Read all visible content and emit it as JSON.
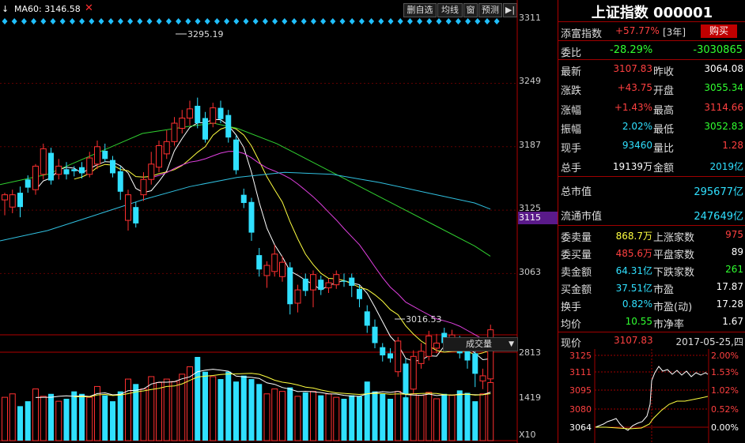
{
  "toolbar": {
    "arrow": "↓",
    "ma60_label": "MA60: 3146.58",
    "buttons": [
      "删自选",
      "均线",
      "窗",
      "预测"
    ],
    "collapse": "▶|"
  },
  "price_axis": [
    "3311",
    "3249",
    "3187",
    "3125",
    "3115",
    "3063"
  ],
  "current_price_tag": "3115",
  "annotations": {
    "high": "3295.19",
    "low": "3016.53"
  },
  "volume_selector": "成交量",
  "volume_axis": [
    "2813",
    "1419",
    "X10"
  ],
  "quote": {
    "title": "上证指数 000001",
    "tianfu_label": "添富指数",
    "tianfu_value": "+57.77%",
    "tianfu_period": "[3年]",
    "buy_button": "购买",
    "weibi_label": "委比",
    "weibi_value": "-28.29%",
    "weibi_diff": "-3030865",
    "rows": [
      {
        "l1": "最新",
        "v1": "3107.83",
        "c1": "red",
        "l2": "昨收",
        "v2": "3064.08",
        "c2": "white"
      },
      {
        "l1": "涨跌",
        "v1": "+43.75",
        "c1": "red",
        "l2": "开盘",
        "v2": "3055.34",
        "c2": "green"
      },
      {
        "l1": "涨幅",
        "v1": "+1.43%",
        "c1": "red",
        "l2": "最高",
        "v2": "3114.66",
        "c2": "red"
      },
      {
        "l1": "振幅",
        "v1": "2.02%",
        "c1": "cyan",
        "l2": "最低",
        "v2": "3052.83",
        "c2": "green"
      },
      {
        "l1": "现手",
        "v1": "93460",
        "c1": "cyan",
        "l2": "量比",
        "v2": "1.28",
        "c2": "red"
      },
      {
        "l1": "总手",
        "v1": "19139万",
        "c1": "white",
        "l2": "金额",
        "v2": "2019亿",
        "c2": "cyan"
      }
    ],
    "total_mv_label": "总市值",
    "total_mv": "295677亿",
    "float_mv_label": "流通市值",
    "float_mv": "247649亿",
    "rows2": [
      {
        "l1": "委卖量",
        "v1": "868.7万",
        "c1": "yellow",
        "l2": "上涨家数",
        "v2": "975",
        "c2": "red"
      },
      {
        "l1": "委买量",
        "v1": "485.6万",
        "c1": "red",
        "l2": "平盘家数",
        "v2": "89",
        "c2": "white"
      },
      {
        "l1": "卖金额",
        "v1": "64.31亿",
        "c1": "cyan",
        "l2": "下跌家数",
        "v2": "261",
        "c2": "green"
      },
      {
        "l1": "买金额",
        "v1": "37.51亿",
        "c1": "cyan",
        "l2": "市盈",
        "v2": "17.87",
        "c2": "white"
      },
      {
        "l1": "换手",
        "v1": "0.82%",
        "c1": "cyan",
        "l2": "市盈(动)",
        "v2": "17.28",
        "c2": "white"
      },
      {
        "l1": "均价",
        "v1": "10.55",
        "c1": "green",
        "l2": "市净率",
        "v2": "1.67",
        "c2": "white"
      }
    ],
    "price_label": "现价",
    "price_value": "3107.83",
    "date": "2017-05-25,四"
  },
  "mini_chart": {
    "left_axis": [
      "3125",
      "3111",
      "3095",
      "3080",
      "3064"
    ],
    "right_axis": [
      "2.00%",
      "1.53%",
      "1.02%",
      "0.52%",
      "0.00%"
    ]
  },
  "chart_data": {
    "type": "candlestick",
    "price_range": [
      3000,
      3315
    ],
    "candles": [
      [
        3135,
        3140,
        3120,
        3142
      ],
      [
        3128,
        3140,
        3122,
        3145
      ],
      [
        3142,
        3128,
        3118,
        3148
      ],
      [
        3155,
        3147,
        3142,
        3159
      ],
      [
        3145,
        3168,
        3140,
        3170
      ],
      [
        3160,
        3185,
        3155,
        3190
      ],
      [
        3181,
        3154,
        3150,
        3186
      ],
      [
        3160,
        3168,
        3155,
        3175
      ],
      [
        3165,
        3160,
        3155,
        3172
      ],
      [
        3165,
        3163,
        3158,
        3168
      ],
      [
        3167,
        3161,
        3156,
        3172
      ],
      [
        3160,
        3176,
        3157,
        3182
      ],
      [
        3170,
        3187,
        3165,
        3193
      ],
      [
        3183,
        3175,
        3172,
        3190
      ],
      [
        3174,
        3161,
        3157,
        3178
      ],
      [
        3163,
        3143,
        3135,
        3168
      ],
      [
        3115,
        3140,
        3105,
        3145
      ],
      [
        3128,
        3112,
        3108,
        3133
      ],
      [
        3140,
        3155,
        3134,
        3162
      ],
      [
        3155,
        3170,
        3150,
        3182
      ],
      [
        3167,
        3188,
        3162,
        3193
      ],
      [
        3180,
        3192,
        3175,
        3203
      ],
      [
        3192,
        3210,
        3188,
        3216
      ],
      [
        3205,
        3215,
        3200,
        3223
      ],
      [
        3215,
        3224,
        3208,
        3232
      ],
      [
        3227,
        3210,
        3205,
        3235
      ],
      [
        3215,
        3194,
        3191,
        3221
      ],
      [
        3210,
        3225,
        3206,
        3230
      ],
      [
        3225,
        3214,
        3210,
        3232
      ],
      [
        3218,
        3196,
        3191,
        3223
      ],
      [
        3194,
        3164,
        3160,
        3198
      ],
      [
        3140,
        3132,
        3127,
        3146
      ],
      [
        3133,
        3103,
        3095,
        3137
      ],
      [
        3081,
        3067,
        3060,
        3088
      ],
      [
        3061,
        3071,
        3049,
        3075
      ],
      [
        3065,
        3082,
        3060,
        3091
      ],
      [
        3060,
        3074,
        3055,
        3080
      ],
      [
        3069,
        3033,
        3023,
        3074
      ],
      [
        3034,
        3047,
        3025,
        3052
      ],
      [
        3058,
        3046,
        3041,
        3063
      ],
      [
        3047,
        3062,
        3030,
        3066
      ],
      [
        3057,
        3047,
        3042,
        3061
      ],
      [
        3049,
        3054,
        3044,
        3058
      ],
      [
        3052,
        3062,
        3048,
        3066
      ],
      [
        3056,
        3055,
        3050,
        3063
      ],
      [
        3059,
        3051,
        3040,
        3063
      ],
      [
        3048,
        3038,
        3030,
        3052
      ],
      [
        3026,
        3012,
        3005,
        3032
      ],
      [
        3011,
        2995,
        2990,
        3018
      ],
      [
        2991,
        2983,
        2977,
        2995
      ],
      [
        2985,
        2980,
        2976,
        2990
      ],
      [
        2967,
        2997,
        2962,
        3001
      ],
      [
        2975,
        2945,
        2940,
        2980
      ],
      [
        2950,
        2982,
        2945,
        2988
      ],
      [
        2975,
        2987,
        2970,
        2995
      ],
      [
        2982,
        3002,
        2978,
        3007
      ],
      [
        2990,
        2995,
        2985,
        3004
      ],
      [
        3005,
        2995,
        2990,
        3010
      ],
      [
        2993,
        3003,
        2988,
        3008
      ],
      [
        2995,
        2985,
        2980,
        3002
      ],
      [
        2988,
        2978,
        2970,
        2993
      ],
      [
        2985,
        2965,
        2952,
        2990
      ],
      [
        2958,
        2963,
        2950,
        2970
      ],
      [
        2960,
        3008,
        2942,
        3013
      ]
    ],
    "volumes": [
      88,
      95,
      70,
      80,
      105,
      90,
      95,
      80,
      85,
      100,
      95,
      88,
      110,
      92,
      80,
      100,
      125,
      115,
      105,
      130,
      118,
      125,
      120,
      135,
      150,
      170,
      140,
      130,
      125,
      140,
      120,
      132,
      125,
      115,
      95,
      105,
      100,
      108,
      90,
      98,
      100,
      92,
      95,
      88,
      85,
      92,
      90,
      120,
      100,
      95,
      85,
      100,
      88,
      95,
      92,
      98,
      85,
      95,
      92,
      102,
      97,
      80,
      95,
      118
    ],
    "volume_max": 2813
  }
}
